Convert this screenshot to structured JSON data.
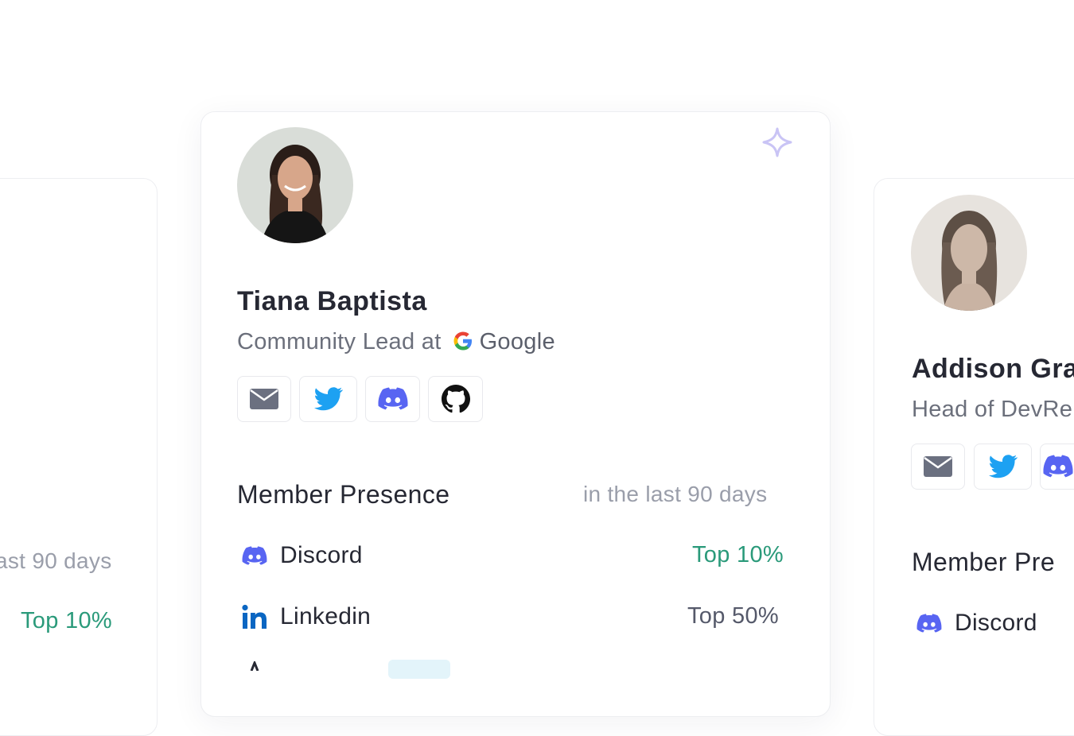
{
  "left_card": {
    "presence_note": "ast 90 days",
    "rank": "Top 10%"
  },
  "main_card": {
    "name": "Tiana Baptista",
    "role": "Community Lead at",
    "company": "Google",
    "social": [
      "email-icon",
      "twitter-icon",
      "discord-icon",
      "github-icon"
    ],
    "presence": {
      "title": "Member Presence",
      "note": "in the last 90 days",
      "rows": [
        {
          "icon": "discord-icon",
          "label": "Discord",
          "rank": "Top 10%"
        },
        {
          "icon": "linkedin-icon",
          "label": "Linkedin",
          "rank": "Top 50%"
        }
      ]
    }
  },
  "right_card": {
    "name": "Addison Gra",
    "role": "Head of DevRe",
    "presence_title": "Member Pre",
    "row_label": "Discord"
  },
  "colors": {
    "discord": "#5865F2",
    "twitter": "#1DA1F2",
    "linkedin": "#0A66C2",
    "rank_green": "#2A9A7A",
    "muted": "#9A9EAA"
  }
}
